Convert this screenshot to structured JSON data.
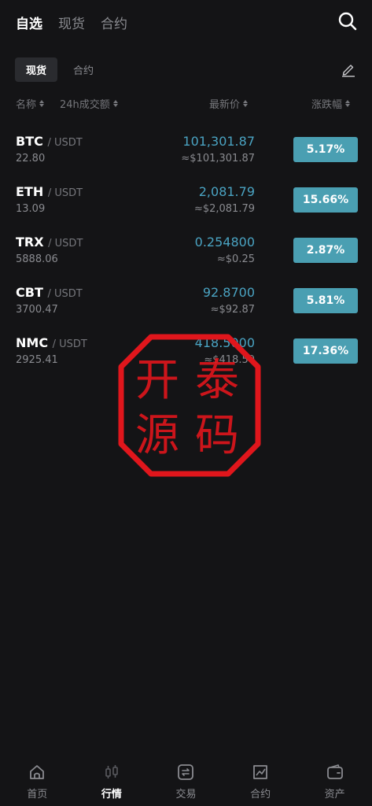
{
  "header": {
    "tabs": [
      {
        "label": "自选",
        "active": true
      },
      {
        "label": "现货",
        "active": false
      },
      {
        "label": "合约",
        "active": false
      }
    ]
  },
  "sub_tabs": [
    {
      "label": "现货",
      "active": true
    },
    {
      "label": "合约",
      "active": false
    }
  ],
  "columns": {
    "name": "名称",
    "volume": "24h成交额",
    "price": "最新价",
    "change": "涨跌幅"
  },
  "rows": [
    {
      "symbol": "BTC",
      "quote": "/ USDT",
      "volume": "22.80",
      "price": "101,301.87",
      "fiat": "≈$101,301.87",
      "change": "5.17%"
    },
    {
      "symbol": "ETH",
      "quote": "/ USDT",
      "volume": "13.09",
      "price": "2,081.79",
      "fiat": "≈$2,081.79",
      "change": "15.66%"
    },
    {
      "symbol": "TRX",
      "quote": "/ USDT",
      "volume": "5888.06",
      "price": "0.254800",
      "fiat": "≈$0.25",
      "change": "2.87%"
    },
    {
      "symbol": "CBT",
      "quote": "/ USDT",
      "volume": "3700.47",
      "price": "92.8700",
      "fiat": "≈$92.87",
      "change": "5.81%"
    },
    {
      "symbol": "NMC",
      "quote": "/ USDT",
      "volume": "2925.41",
      "price": "418.5000",
      "fiat": "≈$418.50",
      "change": "17.36%"
    }
  ],
  "stamp": {
    "chars": [
      "开",
      "泰",
      "源",
      "码"
    ],
    "color": "#e0161c"
  },
  "colors": {
    "accent": "#4aa3c2",
    "change_badge": "#4a9fb2",
    "background": "#141416"
  },
  "bottom_nav": [
    {
      "label": "首页",
      "icon": "home-icon",
      "active": false
    },
    {
      "label": "行情",
      "icon": "candlestick-icon",
      "active": true
    },
    {
      "label": "交易",
      "icon": "exchange-icon",
      "active": false
    },
    {
      "label": "合约",
      "icon": "chart-icon",
      "active": false
    },
    {
      "label": "资产",
      "icon": "wallet-icon",
      "active": false
    }
  ]
}
